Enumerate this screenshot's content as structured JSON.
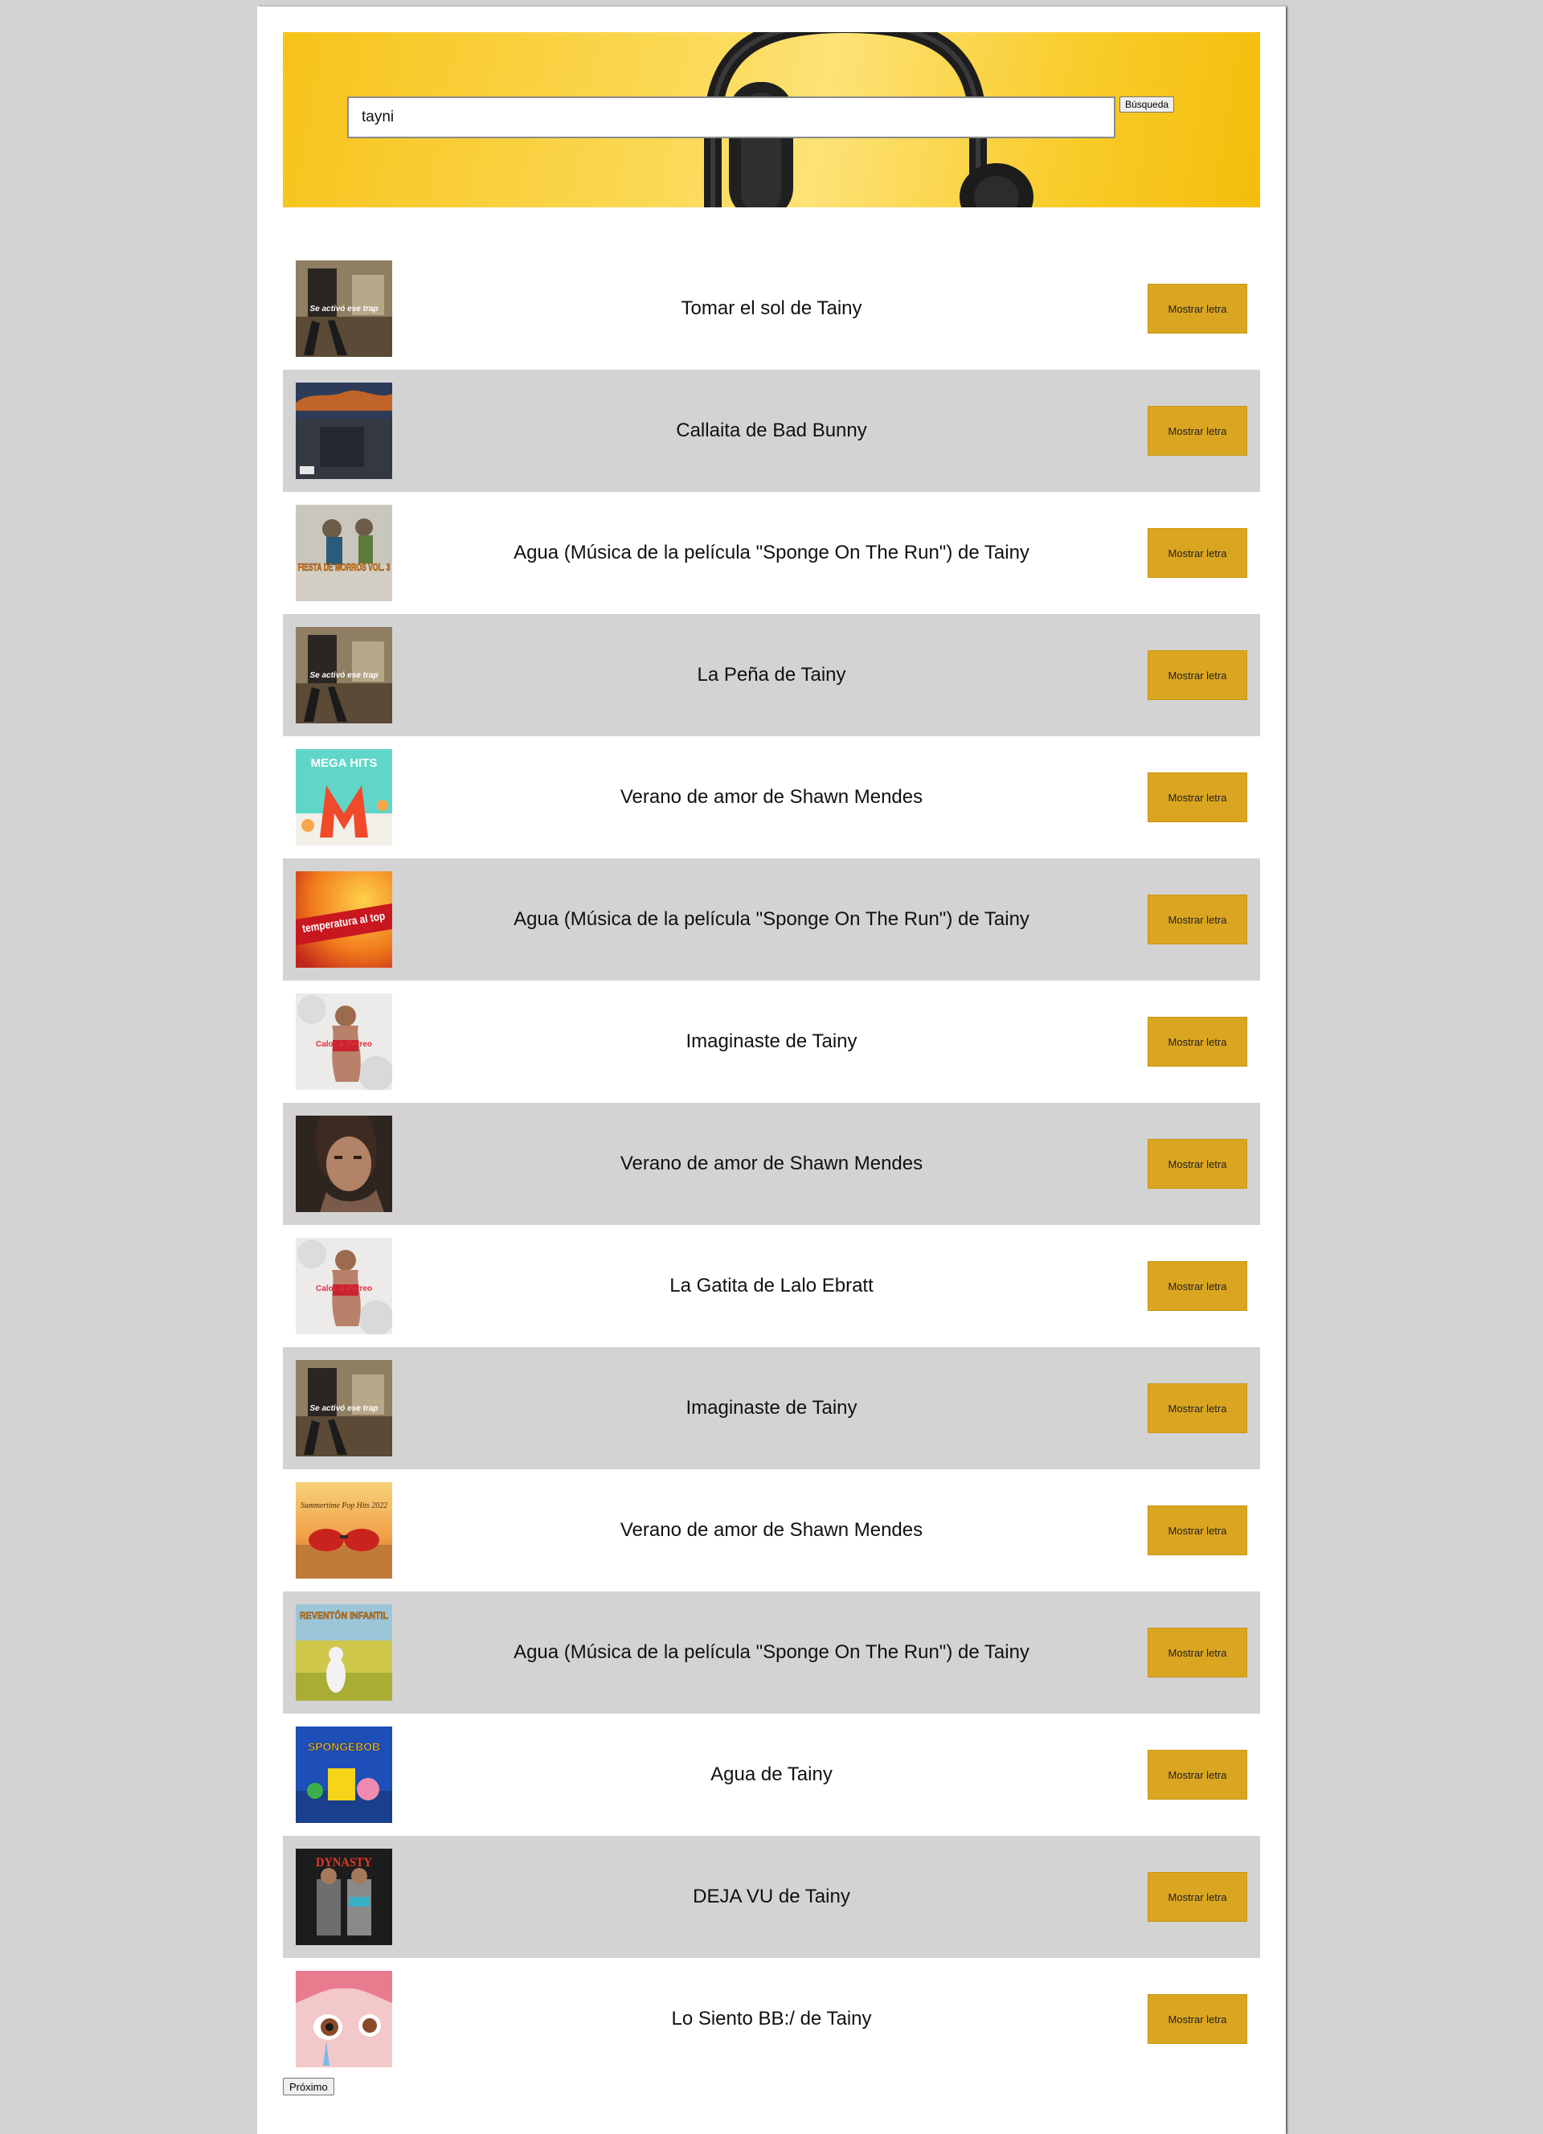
{
  "search": {
    "value": "tayni",
    "button_label": "Búsqueda"
  },
  "results": [
    {
      "title": "Tomar el sol de Tainy",
      "button_label": "Mostrar letra",
      "cover_text": "Se activó ese trap"
    },
    {
      "title": "Callaita de Bad Bunny",
      "button_label": "Mostrar letra",
      "cover_text": ""
    },
    {
      "title": "Agua (Música de la película \"Sponge On The Run\") de Tainy",
      "button_label": "Mostrar letra",
      "cover_text": "FIESTA DE MORROS VOL. 3"
    },
    {
      "title": "La Peña de Tainy",
      "button_label": "Mostrar letra",
      "cover_text": "Se activó ese trap"
    },
    {
      "title": "Verano de amor de Shawn Mendes",
      "button_label": "Mostrar letra",
      "cover_text": "MEGA HITS"
    },
    {
      "title": "Agua (Música de la película \"Sponge On The Run\") de Tainy",
      "button_label": "Mostrar letra",
      "cover_text": "temperatura al top"
    },
    {
      "title": "Imaginaste de Tainy",
      "button_label": "Mostrar letra",
      "cover_text": "Calor & Perreo"
    },
    {
      "title": "Verano de amor de Shawn Mendes",
      "button_label": "Mostrar letra",
      "cover_text": ""
    },
    {
      "title": "La Gatita de Lalo Ebratt",
      "button_label": "Mostrar letra",
      "cover_text": "Calor & Perreo"
    },
    {
      "title": "Imaginaste de Tainy",
      "button_label": "Mostrar letra",
      "cover_text": "Se activó ese trap"
    },
    {
      "title": "Verano de amor de Shawn Mendes",
      "button_label": "Mostrar letra",
      "cover_text": "Summertime Pop Hits 2022"
    },
    {
      "title": "Agua (Música de la película \"Sponge On The Run\") de Tainy",
      "button_label": "Mostrar letra",
      "cover_text": "REVENTÓN INFANTIL"
    },
    {
      "title": "Agua de Tainy",
      "button_label": "Mostrar letra",
      "cover_text": "SPONGEBOB"
    },
    {
      "title": "DEJA VU de Tainy",
      "button_label": "Mostrar letra",
      "cover_text": "DYNASTY"
    },
    {
      "title": "Lo Siento BB:/ de Tainy",
      "button_label": "Mostrar letra",
      "cover_text": ""
    }
  ],
  "pagination": {
    "next_label": "Próximo"
  }
}
